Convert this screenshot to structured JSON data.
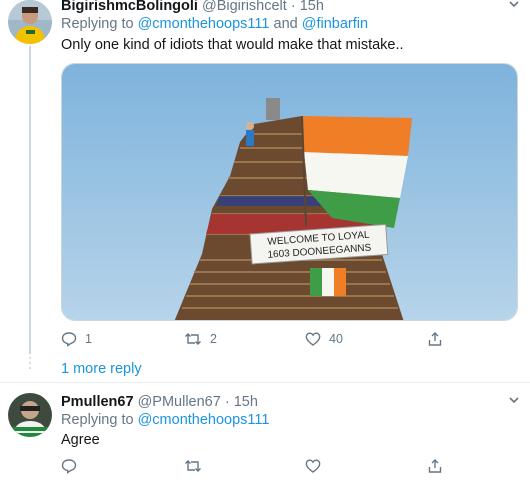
{
  "tweet1": {
    "display_name": "BigirishmcBolingoli",
    "handle": "@Bigirishcelt",
    "separator": "·",
    "time": "15h",
    "replying_label": "Replying to",
    "mention1": "@cmonthehoops111",
    "and_word": "and",
    "mention2": "@finbarfin",
    "text": "Only one kind of idiots that would make that mistake..",
    "image_banner_line1": "WELCOME TO LOYAL",
    "image_banner_line2": "1603  DOONEEGANNS",
    "reply_count": "1",
    "retweet_count": "2",
    "like_count": "40",
    "caret_icon": "chevron-down-icon"
  },
  "more_replies": "1 more reply",
  "tweet2": {
    "display_name": "Pmullen67",
    "handle": "@PMullen67",
    "separator": "·",
    "time": "15h",
    "replying_label": "Replying to",
    "mention1": "@cmonthehoops111",
    "text": "Agree",
    "caret_icon": "chevron-down-icon"
  },
  "colors": {
    "link": "#1b95e0",
    "muted": "#657786",
    "text": "#14171a",
    "border": "#e6ecf0"
  }
}
